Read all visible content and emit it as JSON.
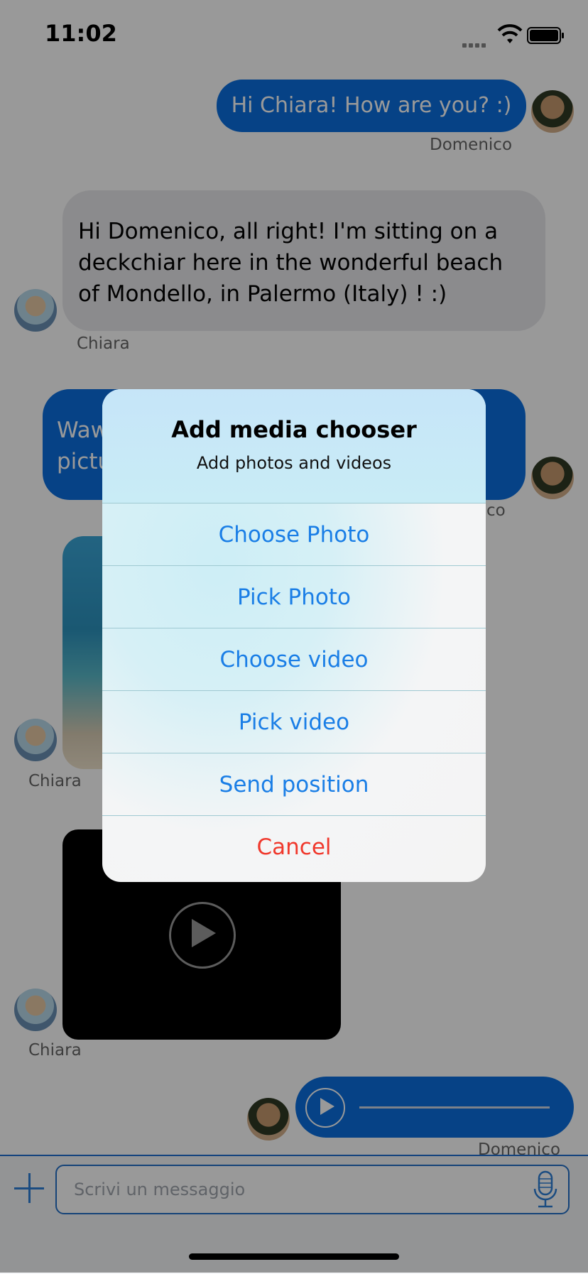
{
  "status_bar": {
    "time": "11:02"
  },
  "messages": [
    {
      "text": "Hi Chiara! How are you? :)",
      "sender": "Domenico"
    },
    {
      "text": "Hi Domenico, all right! I'm sitting on a deckchiar here in the wonderful beach of Mondello, in Palermo (Italy) ! :)",
      "sender": "Chiara"
    },
    {
      "text_partial": "Waw",
      "text_partial2": "pictu",
      "sender_partial": "nico"
    },
    {
      "sender": "Chiara"
    },
    {
      "sender": "Chiara"
    },
    {
      "sender": "Domenico"
    }
  ],
  "input": {
    "placeholder": "Scrivi un messaggio"
  },
  "action_sheet": {
    "title": "Add media chooser",
    "subtitle": "Add photos and videos",
    "options": [
      "Choose Photo",
      "Pick Photo",
      "Choose video",
      "Pick video",
      "Send position"
    ],
    "cancel": "Cancel"
  },
  "colors": {
    "bubble_blue": "#0a6fe0",
    "bubble_gray": "#e8e8ec",
    "sheet_button": "#1a7ee6",
    "cancel_red": "#f0382c",
    "input_border": "#2370c9"
  },
  "icons": [
    "signal-icon",
    "wifi-icon",
    "battery-icon",
    "plus-icon",
    "microphone-icon",
    "play-icon"
  ]
}
